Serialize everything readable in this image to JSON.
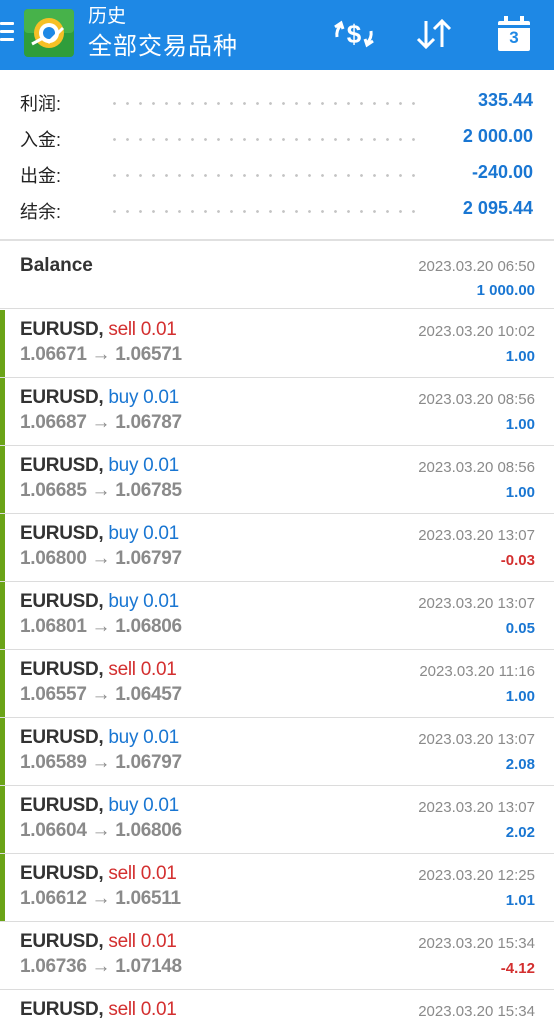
{
  "appbar": {
    "subtitle": "历史",
    "title": "全部交易品种",
    "colors": {
      "background": "#1e88e5",
      "text": "#ffffff"
    },
    "actions": [
      {
        "icon": "currency-exchange-icon"
      },
      {
        "icon": "sort-icon"
      },
      {
        "icon": "calendar-icon",
        "day": "3"
      }
    ]
  },
  "summary": {
    "profit": {
      "label": "利润:",
      "value": "335.44"
    },
    "deposit": {
      "label": "入金:",
      "value": "2 000.00"
    },
    "withdrawal": {
      "label": "出金:",
      "value": "-240.00"
    },
    "balance": {
      "label": "结余:",
      "value": "2 095.44"
    }
  },
  "balance_entry": {
    "label": "Balance",
    "time": "2023.03.20 06:50",
    "amount": "1 000.00"
  },
  "deals": [
    {
      "symbol": "EURUSD,",
      "type": "sell 0.01",
      "direction": "sell",
      "prices": "1.06671 → 1.06571",
      "time": "2023.03.20 10:02",
      "profit": "1.00",
      "closed_marker": true
    },
    {
      "symbol": "EURUSD,",
      "type": "buy 0.01",
      "direction": "buy",
      "prices": "1.06687 → 1.06787",
      "time": "2023.03.20 08:56",
      "profit": "1.00",
      "closed_marker": true
    },
    {
      "symbol": "EURUSD,",
      "type": "buy 0.01",
      "direction": "buy",
      "prices": "1.06685 → 1.06785",
      "time": "2023.03.20 08:56",
      "profit": "1.00",
      "closed_marker": true
    },
    {
      "symbol": "EURUSD,",
      "type": "buy 0.01",
      "direction": "buy",
      "prices": "1.06800 → 1.06797",
      "time": "2023.03.20 13:07",
      "profit": "-0.03",
      "closed_marker": true
    },
    {
      "symbol": "EURUSD,",
      "type": "buy 0.01",
      "direction": "buy",
      "prices": "1.06801 → 1.06806",
      "time": "2023.03.20 13:07",
      "profit": "0.05",
      "closed_marker": true
    },
    {
      "symbol": "EURUSD,",
      "type": "sell 0.01",
      "direction": "sell",
      "prices": "1.06557 → 1.06457",
      "time": "2023.03.20 11:16",
      "profit": "1.00",
      "closed_marker": true
    },
    {
      "symbol": "EURUSD,",
      "type": "buy 0.01",
      "direction": "buy",
      "prices": "1.06589 → 1.06797",
      "time": "2023.03.20 13:07",
      "profit": "2.08",
      "closed_marker": true
    },
    {
      "symbol": "EURUSD,",
      "type": "buy 0.01",
      "direction": "buy",
      "prices": "1.06604 → 1.06806",
      "time": "2023.03.20 13:07",
      "profit": "2.02",
      "closed_marker": true
    },
    {
      "symbol": "EURUSD,",
      "type": "sell 0.01",
      "direction": "sell",
      "prices": "1.06612 → 1.06511",
      "time": "2023.03.20 12:25",
      "profit": "1.01",
      "closed_marker": true
    },
    {
      "symbol": "EURUSD,",
      "type": "sell 0.01",
      "direction": "sell",
      "prices": "1.06736 → 1.07148",
      "time": "2023.03.20 15:34",
      "profit": "-4.12",
      "closed_marker": false
    },
    {
      "symbol": "EURUSD,",
      "type": "sell 0.01",
      "direction": "sell",
      "prices": "",
      "time": "2023.03.20 15:34",
      "profit": "",
      "closed_marker": false
    }
  ],
  "colors": {
    "profit_positive": "#1976d2",
    "profit_negative": "#d32f2f",
    "marker": "#6aa317",
    "muted": "#8a8a8a"
  }
}
